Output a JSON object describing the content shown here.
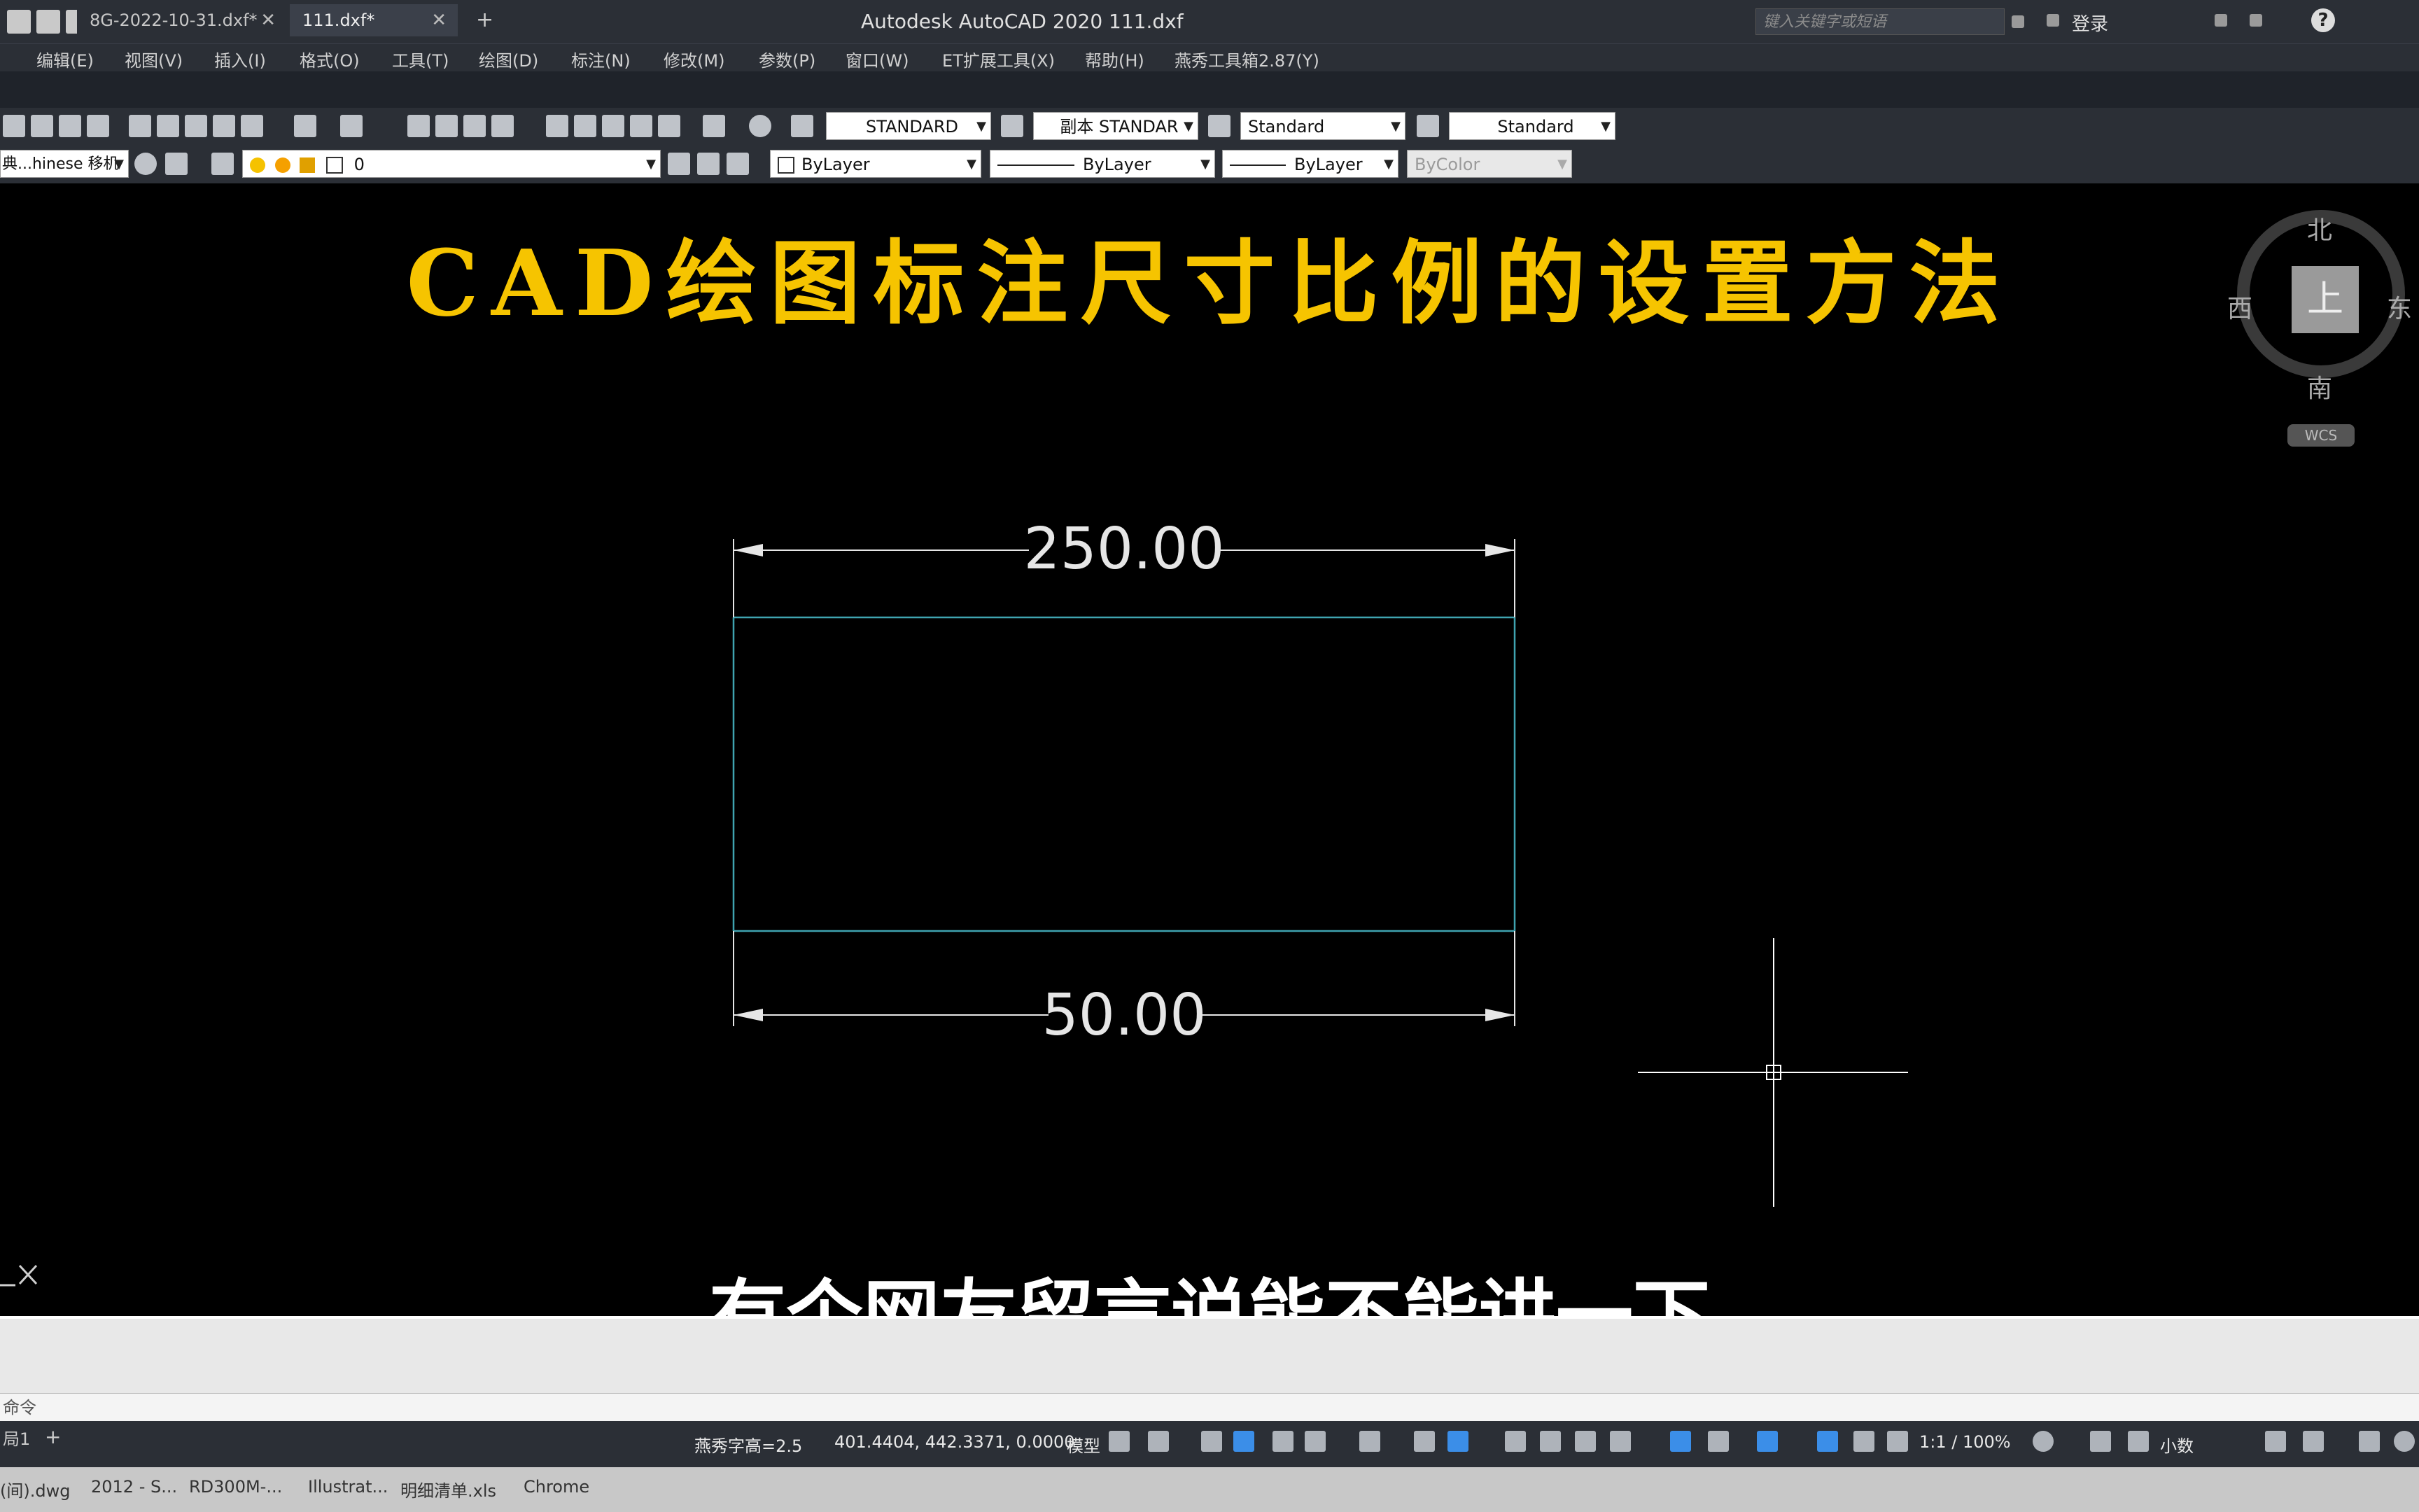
{
  "window": {
    "title": "Autodesk AutoCAD 2020    111.dxf"
  },
  "search": {
    "placeholder": "键入关键字或短语"
  },
  "account": {
    "login": "登录"
  },
  "menu": [
    "编辑(E)",
    "视图(V)",
    "插入(I)",
    "格式(O)",
    "工具(T)",
    "绘图(D)",
    "标注(N)",
    "修改(M)",
    "参数(P)",
    "窗口(W)",
    "ET扩展工具(X)",
    "帮助(H)",
    "燕秀工具箱2.87(Y)"
  ],
  "tabs": [
    {
      "label": "8G-2022-10-31.dxf*",
      "close": "✕"
    },
    {
      "label": "111.dxf*",
      "close": "✕"
    }
  ],
  "tab_add": "+",
  "styles": {
    "text_style": "STANDARD",
    "dim_style": "副本 STANDAR",
    "table_style": "Standard",
    "mleader_style": "Standard"
  },
  "layers": {
    "workspace": "典...hinese 移机",
    "layer_name": "0",
    "color": "ByLayer",
    "linetype": "ByLayer",
    "lineweight": "ByLayer",
    "plotstyle": "ByColor"
  },
  "drawing": {
    "top_dimension": "250.00",
    "bottom_dimension": "50.00",
    "line_color": "#3fa3b0",
    "dim_color": "#e6e6e6"
  },
  "overlay": {
    "title": "CAD绘图标注尺寸比例的设置方法",
    "subtitle": "有个网友留言说能不能讲一下",
    "title_color": "#f6c400"
  },
  "viewcube": {
    "north": "北",
    "south": "南",
    "east": "东",
    "west": "西",
    "top": "上",
    "wcs": "WCS"
  },
  "command": {
    "prompt": "命令"
  },
  "status": {
    "layout": "局1",
    "text_height": "燕秀字高=2.5",
    "coordinates": "401.4404, 442.3371, 0.0000",
    "model": "模型",
    "scale": "1:1 / 100%",
    "units": "小数"
  },
  "taskbar": [
    "(间).dwg",
    "2012 - S...",
    "RD300M-...",
    "Illustrat...",
    "明细清单.xls",
    "Chrome"
  ]
}
